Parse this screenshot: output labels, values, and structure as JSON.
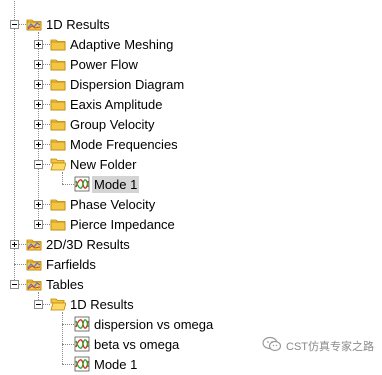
{
  "tree": [
    {
      "label": "1D Results",
      "icon": "result-folder-icon",
      "depth": 0,
      "expander": "minus",
      "partial": true
    },
    {
      "label": "Adaptive Meshing",
      "icon": "folder-icon",
      "depth": 1,
      "expander": "plus"
    },
    {
      "label": "Power Flow",
      "icon": "folder-icon",
      "depth": 1,
      "expander": "plus"
    },
    {
      "label": "Dispersion Diagram",
      "icon": "folder-icon",
      "depth": 1,
      "expander": "plus"
    },
    {
      "label": "Eaxis Amplitude",
      "icon": "folder-icon",
      "depth": 1,
      "expander": "plus"
    },
    {
      "label": "Group Velocity",
      "icon": "folder-icon",
      "depth": 1,
      "expander": "plus"
    },
    {
      "label": "Mode Frequencies",
      "icon": "folder-icon",
      "depth": 1,
      "expander": "plus"
    },
    {
      "label": "New Folder",
      "icon": "open-folder-icon",
      "depth": 1,
      "expander": "minus"
    },
    {
      "label": "Mode 1",
      "icon": "curve-plot-icon",
      "depth": 2,
      "selected": true
    },
    {
      "label": "Phase Velocity",
      "icon": "folder-icon",
      "depth": 1,
      "expander": "plus"
    },
    {
      "label": "Pierce Impedance",
      "icon": "folder-icon",
      "depth": 1,
      "expander": "plus"
    },
    {
      "label": "2D/3D Results",
      "icon": "result-folder-icon",
      "depth": 0,
      "expander": "plus"
    },
    {
      "label": "Farfields",
      "icon": "result-folder-icon",
      "depth": 0
    },
    {
      "label": "Tables",
      "icon": "result-folder-icon",
      "depth": 0,
      "expander": "minus"
    },
    {
      "label": "1D Results",
      "icon": "open-folder-icon",
      "depth": 1,
      "expander": "minus"
    },
    {
      "label": "dispersion vs omega",
      "icon": "curve-plot-icon",
      "depth": 2
    },
    {
      "label": "beta vs omega",
      "icon": "curve-plot-icon",
      "depth": 2
    },
    {
      "label": "Mode 1",
      "icon": "curve-plot-icon",
      "depth": 2
    }
  ],
  "watermark": {
    "text": "CST仿真专家之路",
    "icon": "wechat-icon"
  },
  "colors": {
    "folder": "#f4c542",
    "folder_dark": "#b8860b",
    "selection": "#d4d4d4",
    "curve_red": "#d22",
    "curve_green": "#2a2"
  }
}
